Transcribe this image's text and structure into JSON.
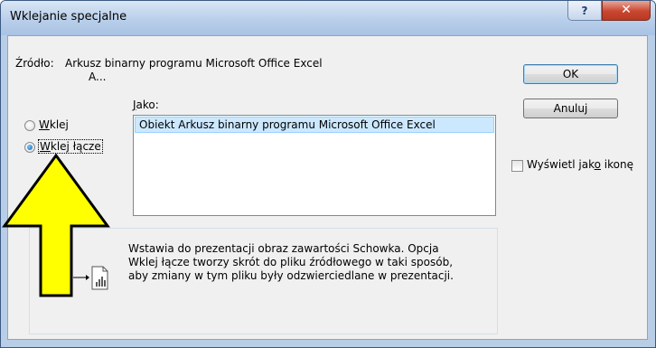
{
  "window": {
    "title": "Wklejanie specjalne",
    "help_label": "?",
    "close_label": "✕"
  },
  "source": {
    "label": "Źródło:",
    "value_line1": "Arkusz binarny programu Microsoft Office Excel",
    "value_line2": "A..."
  },
  "as_label": "Jako:",
  "options": {
    "paste_label": "Wklej",
    "paste_link_label": "Wklej łącze",
    "selected": "paste_link"
  },
  "list": {
    "items": [
      "Obiekt Arkusz binarny programu Microsoft Office Excel"
    ],
    "selected_index": 0
  },
  "buttons": {
    "ok": "OK",
    "cancel": "Anuluj"
  },
  "display_as_icon": {
    "label": "Wyświetl jako ikonę",
    "checked": false
  },
  "result": {
    "text": "Wstawia do prezentacji obraz zawartości Schowka. Opcja\nWklej łącze tworzy skrót do pliku źródłowego w taki sposób,\naby zmiany w tym pliku były odzwierciedlane w prezentacji."
  },
  "colors": {
    "arrow_fill": "#ffff00",
    "arrow_stroke": "#000000",
    "selection": "#cce8ff",
    "close_button": "#c9462f"
  },
  "icons": [
    "help-icon",
    "close-icon",
    "paste-link-result-icon",
    "annotation-arrow"
  ]
}
